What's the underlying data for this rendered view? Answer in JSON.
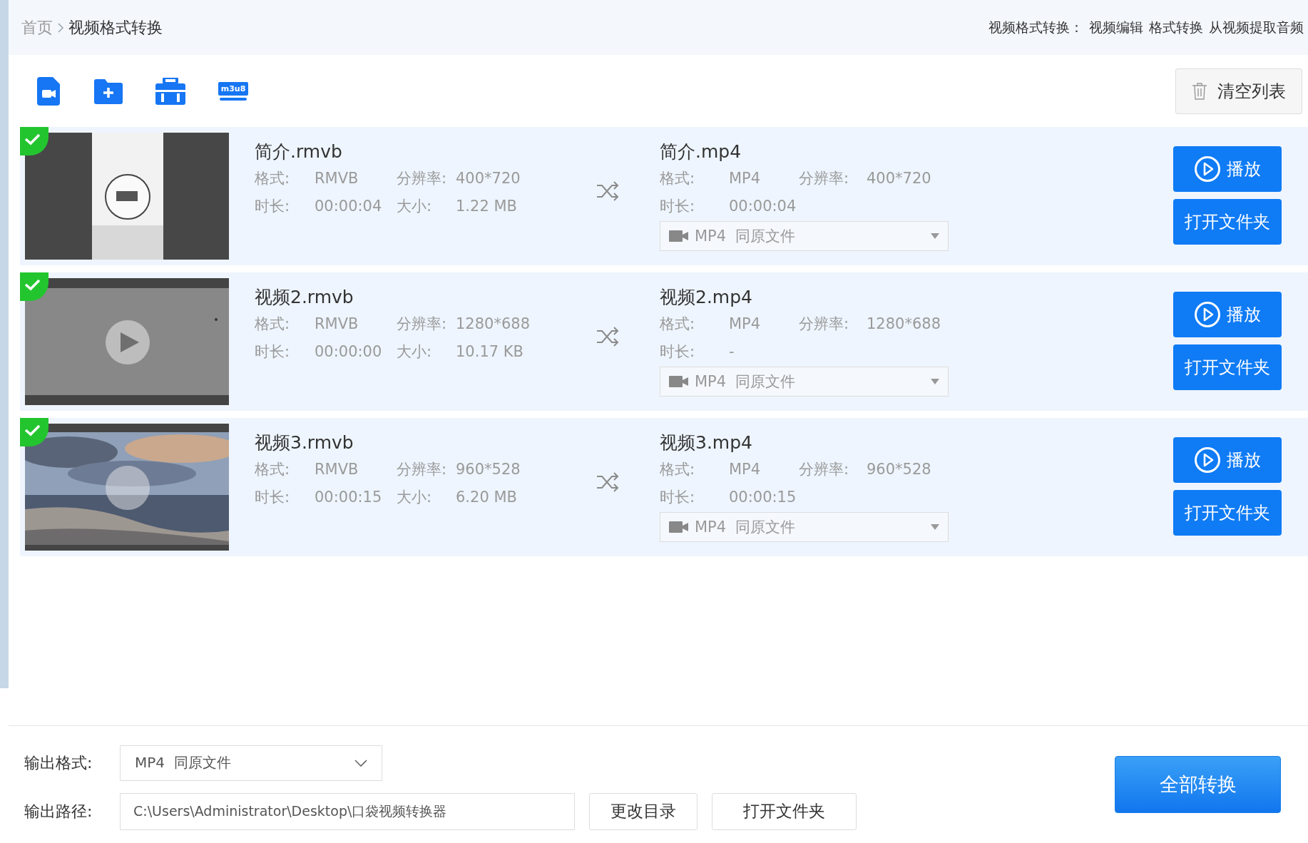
{
  "breadcrumb": [
    {
      "label": "首页",
      "selected": false
    },
    {
      "label": "视频格式转换",
      "selected": true
    }
  ],
  "header_links": {
    "label": "视频格式转换：",
    "links": [
      "视频编辑",
      "格式转换",
      "从视频提取音频"
    ]
  },
  "toolbar": {
    "m3u8_label": "m3u8",
    "clear_button": "清空列表"
  },
  "files": [
    {
      "checked": true,
      "source": {
        "name": "简介.rmvb",
        "format_label": "格式:",
        "format": "RMVB",
        "resolution_label": "分辨率:",
        "resolution": "400*720",
        "duration_label": "时长:",
        "duration": "00:00:04",
        "size_label": "大小:",
        "size": "1.22 MB"
      },
      "target": {
        "name": "简介.mp4",
        "format_label": "格式:",
        "format": "MP4",
        "resolution_label": "分辨率:",
        "resolution": "400*720",
        "duration_label": "时长:",
        "duration": "00:00:04"
      },
      "output_format": "MP4  同原文件",
      "play_button": "播放",
      "open_folder_button": "打开文件夹"
    },
    {
      "checked": true,
      "source": {
        "name": "视频2.rmvb",
        "format_label": "格式:",
        "format": "RMVB",
        "resolution_label": "分辨率:",
        "resolution": "1280*688",
        "duration_label": "时长:",
        "duration": "00:00:00",
        "size_label": "大小:",
        "size": "10.17 KB"
      },
      "target": {
        "name": "视频2.mp4",
        "format_label": "格式:",
        "format": "MP4",
        "resolution_label": "分辨率:",
        "resolution": "1280*688",
        "duration_label": "时长:",
        "duration": "-"
      },
      "output_format": "MP4  同原文件",
      "play_button": "播放",
      "open_folder_button": "打开文件夹"
    },
    {
      "checked": true,
      "source": {
        "name": "视频3.rmvb",
        "format_label": "格式:",
        "format": "RMVB",
        "resolution_label": "分辨率:",
        "resolution": "960*528",
        "duration_label": "时长:",
        "duration": "00:00:15",
        "size_label": "大小:",
        "size": "6.20 MB"
      },
      "target": {
        "name": "视频3.mp4",
        "format_label": "格式:",
        "format": "MP4",
        "resolution_label": "分辨率:",
        "resolution": "960*528",
        "duration_label": "时长:",
        "duration": "00:00:15"
      },
      "output_format": "MP4  同原文件",
      "play_button": "播放",
      "open_folder_button": "打开文件夹"
    }
  ],
  "output": {
    "format_label": "输出格式:",
    "format": "MP4  同原文件",
    "path_label": "输出路径:",
    "path": "C:\\Users\\Administrator\\Desktop\\口袋视频转换器",
    "change_dir_button": "更改目录",
    "open_folder_button": "打开文件夹",
    "convert_all_button": "全部转换"
  }
}
